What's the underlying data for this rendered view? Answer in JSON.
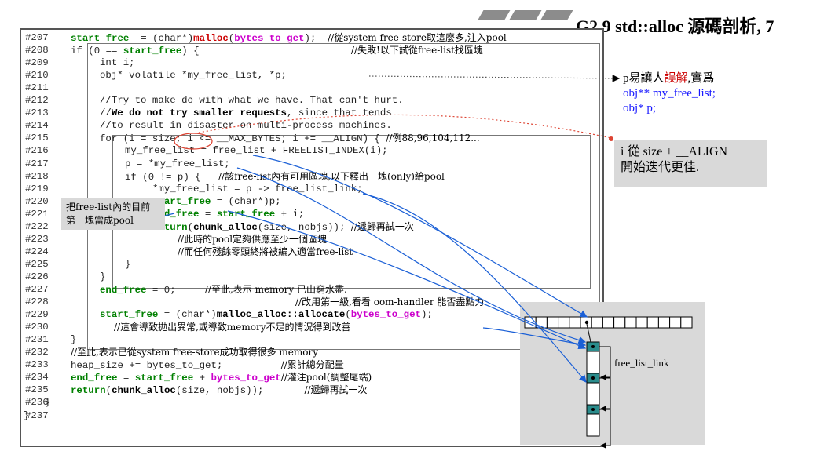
{
  "header": {
    "title": "G2.9 std::alloc 源碼剖析, 7"
  },
  "code_lines": [
    {
      "num": "#207",
      "segs": [
        [
          "kw",
          "start free"
        ],
        [
          "",
          "  = (char*)"
        ],
        [
          "fn",
          "malloc"
        ],
        [
          "",
          "("
        ],
        [
          "pk",
          "bytes to get"
        ],
        [
          "",
          ");  "
        ],
        [
          "cm",
          "//從system free-store取這麼多,注入pool"
        ]
      ],
      "indent": 90
    },
    {
      "num": "#208",
      "segs": [
        [
          "",
          "if (0 == "
        ],
        [
          "kw",
          "start_free"
        ],
        [
          "",
          ") {                          "
        ],
        [
          "cm",
          "//失敗!以下試從free-list找區塊"
        ]
      ],
      "indent": 90
    },
    {
      "num": "#209",
      "segs": [
        [
          "",
          "int i;"
        ]
      ],
      "indent": 127
    },
    {
      "num": "#210",
      "segs": [
        [
          "",
          "obj* volatile *my_free_list, *p;"
        ]
      ],
      "indent": 127
    },
    {
      "num": "#211",
      "segs": [],
      "indent": 127
    },
    {
      "num": "#212",
      "segs": [
        [
          "",
          "//Try to make do with what we have. That can't hurt."
        ]
      ],
      "indent": 127
    },
    {
      "num": "#213",
      "segs": [
        [
          "",
          "//"
        ],
        [
          "bd",
          "We do not try smaller requests"
        ],
        [
          "",
          ", since that tends"
        ]
      ],
      "indent": 127
    },
    {
      "num": "#214",
      "segs": [
        [
          "",
          "//to result in disaster on multi-process machines."
        ]
      ],
      "indent": 127
    },
    {
      "num": "#215",
      "segs": [
        [
          "",
          "for (i = size; i <= __MAX_BYTES; i += __ALIGN) { "
        ],
        [
          "cm",
          "//例88,96,104,112..."
        ]
      ],
      "indent": 127
    },
    {
      "num": "#216",
      "segs": [
        [
          "",
          "my_free_list = free_list + FREELIST_INDEX(i);"
        ]
      ],
      "indent": 159
    },
    {
      "num": "#217",
      "segs": [
        [
          "",
          "p = *my_free_list;"
        ]
      ],
      "indent": 159
    },
    {
      "num": "#218",
      "segs": [
        [
          "",
          "if (0 != p) {   "
        ],
        [
          "cm",
          "//該free-list內有可用區塊,以下釋出一塊(only)給pool"
        ]
      ],
      "indent": 159
    },
    {
      "num": "#219",
      "segs": [
        [
          "",
          "*my_free_list = p -> free_list_link;"
        ]
      ],
      "indent": 194
    },
    {
      "num": "#220",
      "segs": [
        [
          "kw",
          "start_free"
        ],
        [
          "",
          " = (char*)p;"
        ]
      ],
      "indent": 194
    },
    {
      "num": "#221",
      "segs": [
        [
          "kw",
          "end_free"
        ],
        [
          "",
          " = "
        ],
        [
          "kw",
          "start_free"
        ],
        [
          "",
          " + i;"
        ]
      ],
      "indent": 194
    },
    {
      "num": "#222",
      "segs": [
        [
          "kw",
          "return"
        ],
        [
          "",
          "("
        ],
        [
          "bd",
          "chunk_alloc"
        ],
        [
          "",
          "(size, nobjs)); "
        ],
        [
          "cm",
          "//遞歸再試一次"
        ]
      ],
      "indent": 194
    },
    {
      "num": "#223",
      "segs": [
        [
          "cm",
          "//此時的pool定夠供應至少一個區塊"
        ]
      ],
      "indent": 226
    },
    {
      "num": "#224",
      "segs": [
        [
          "cm",
          "//而任何殘餘零頭終將被編入適當free-list"
        ]
      ],
      "indent": 226
    },
    {
      "num": "#225",
      "segs": [
        [
          "",
          "}"
        ]
      ],
      "indent": 159
    },
    {
      "num": "#226",
      "segs": [
        [
          "",
          "}"
        ]
      ],
      "indent": 127
    },
    {
      "num": "#227",
      "segs": [
        [
          "kw",
          "end_free"
        ],
        [
          "",
          " = 0;     "
        ],
        [
          "cm",
          "//至此,表示 memory 已山窮水盡."
        ]
      ],
      "indent": 127
    },
    {
      "num": "#228",
      "segs": [
        [
          "cm",
          "//改用第一級,看看 oom-handler 能否盡點力"
        ]
      ],
      "indent": 376
    },
    {
      "num": "#229",
      "segs": [
        [
          "kw",
          "start_free"
        ],
        [
          "",
          " = (char*)"
        ],
        [
          "bd",
          "malloc_alloc::allocate"
        ],
        [
          "",
          "("
        ],
        [
          "pk",
          "bytes_to_get"
        ],
        [
          "",
          ");"
        ]
      ],
      "indent": 127
    },
    {
      "num": "#230",
      "segs": [
        [
          "cm",
          "//這會導致拋出異常,或導致memory不足的情況得到改善"
        ]
      ],
      "indent": 145
    },
    {
      "num": "#231",
      "segs": [
        [
          "",
          "}"
        ]
      ],
      "indent": 90
    },
    {
      "num": "#232",
      "segs": [
        [
          "cm",
          "//至此,表示已從system free-store成功取得很多 memory"
        ]
      ],
      "indent": 90
    },
    {
      "num": "#233",
      "segs": [
        [
          "",
          "heap_size += bytes_to_get;          "
        ],
        [
          "cm",
          "//累計總分配量"
        ]
      ],
      "indent": 90
    },
    {
      "num": "#234",
      "segs": [
        [
          "kw",
          "end_free"
        ],
        [
          "",
          " = "
        ],
        [
          "kw",
          "start_free"
        ],
        [
          "",
          " + "
        ],
        [
          "pk",
          "bytes_to_get"
        ],
        [
          ";  "
        ],
        [
          "cm",
          "//灌注pool(調整尾端)"
        ]
      ],
      "indent": 90
    },
    {
      "num": "#235",
      "segs": [
        [
          "kw",
          "return"
        ],
        [
          "",
          "("
        ],
        [
          "bd",
          "chunk_alloc"
        ],
        [
          "",
          "(size, nobjs));       "
        ],
        [
          "cm",
          "//遞歸再試一次"
        ]
      ],
      "indent": 90
    },
    {
      "num": "#236",
      "segs": [
        [
          "",
          "}"
        ]
      ],
      "indent": 57
    },
    {
      "num": "#237",
      "segs": [
        [
          "",
          "}"
        ]
      ],
      "indent": 30
    }
  ],
  "notes": {
    "right_line1_a": "p易讓人",
    "right_line1_red": "誤解",
    "right_line1_b": ",實爲",
    "right_line2": "obj** my_free_list;",
    "right_line3": "obj* p;",
    "gray_line1": "i 從 size + __ALIGN",
    "gray_line2": "開始迭代更佳.",
    "left_line1": "把free-list內的目前",
    "left_line2": "第一塊當成pool",
    "diagram_label": "free_list_link"
  },
  "colors": {
    "keyword": "#008000",
    "malloc": "#cc0000",
    "param": "#cc00cc",
    "arrow": "#1a5fd6",
    "teal_block": "#2a8c8c"
  }
}
